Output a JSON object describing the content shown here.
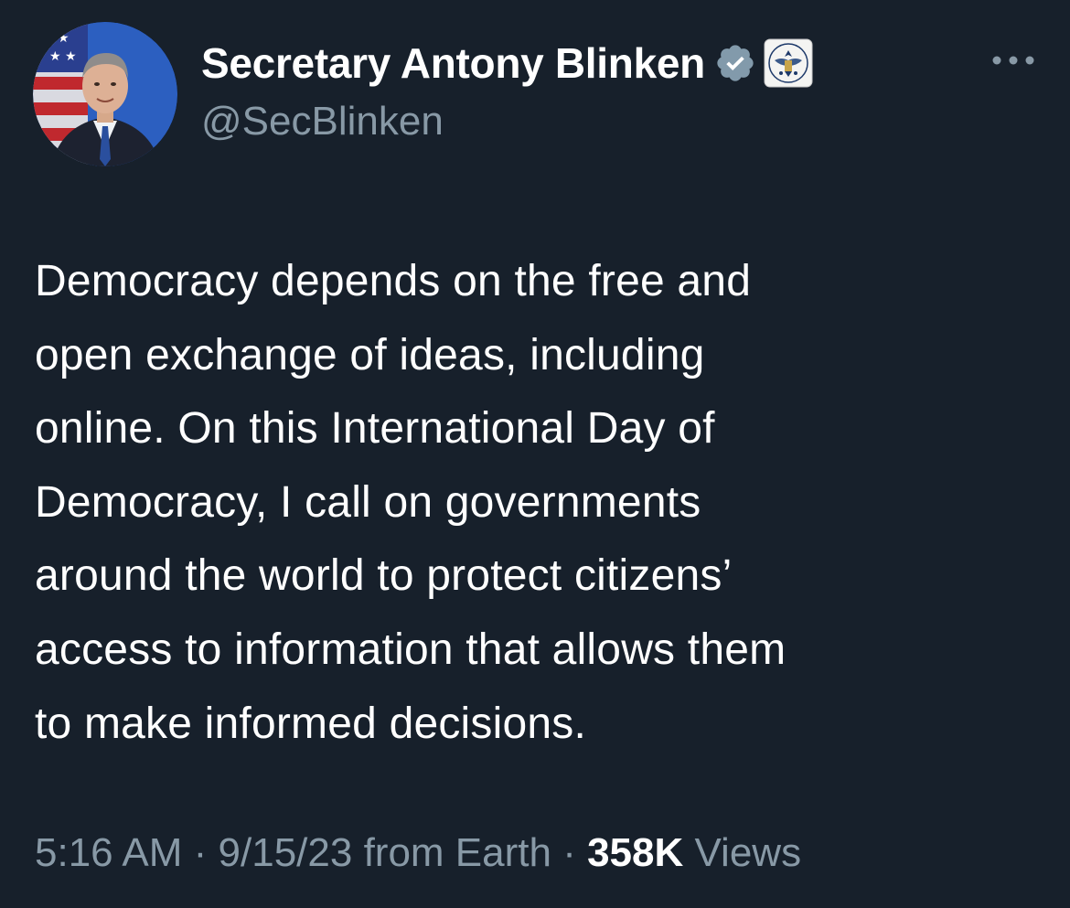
{
  "author": {
    "display_name": "Secretary Antony Blinken",
    "handle": "@SecBlinken",
    "avatar_icon": "profile-photo",
    "verified_icon": "verified-badge-icon",
    "affiliation_icon": "us-state-department-seal-icon"
  },
  "menu": {
    "more_icon": "more-options-icon"
  },
  "tweet": {
    "text": "Democracy depends on the free and\nopen exchange of ideas, including\nonline. On this International Day of\nDemocracy, I call on governments\naround the world to protect citizens’\naccess to information that allows them\nto make informed decisions."
  },
  "meta": {
    "time": "5:16 AM",
    "separator_1": " · ",
    "date_source": "9/15/23 from Earth",
    "separator_2": " · ",
    "views_count": "358K",
    "views_label": " Views"
  },
  "colors": {
    "background": "#17202b",
    "secondary_text": "#8899a6",
    "primary_text": "#ffffff",
    "verified_badge": "#829aab"
  }
}
